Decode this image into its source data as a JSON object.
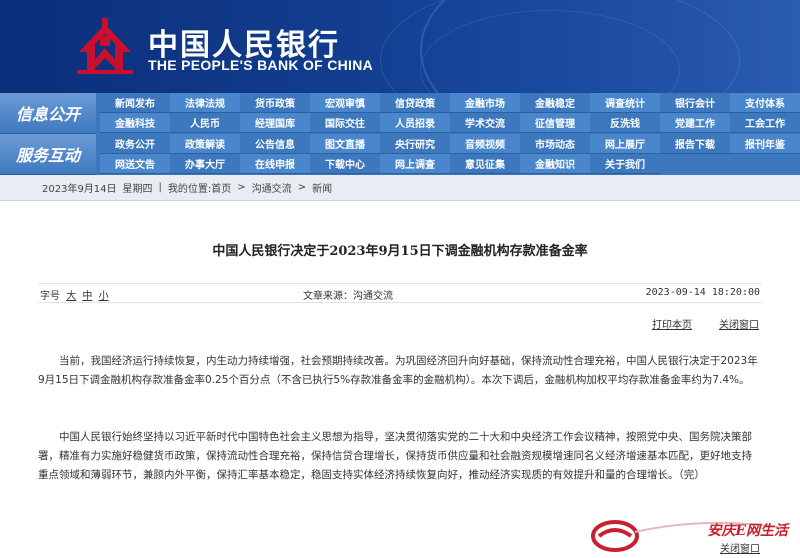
{
  "brand": {
    "name_cn": "中国人民银行",
    "name_en": "THE PEOPLE'S BANK OF CHINA",
    "logo": "pboc-logo-icon",
    "banner_color": "#123c8d",
    "logo_color": "#c8102e"
  },
  "nav": {
    "sections": [
      {
        "label": "信息公开",
        "rows": [
          [
            "新闻发布",
            "法律法规",
            "货币政策",
            "宏观审慎",
            "信贷政策",
            "金融市场",
            "金融稳定",
            "调查统计",
            "银行会计",
            "支付体系"
          ],
          [
            "金融科技",
            "人民币",
            "经理国库",
            "国际交往",
            "人员招录",
            "学术交流",
            "征信管理",
            "反洗钱",
            "党建工作",
            "工会工作"
          ]
        ]
      },
      {
        "label": "服务互动",
        "rows": [
          [
            "政务公开",
            "政策解读",
            "公告信息",
            "图文直播",
            "央行研究",
            "音频视频",
            "市场动态",
            "网上展厅",
            "报告下载",
            "报刊年鉴"
          ],
          [
            "网送文告",
            "办事大厅",
            "在线申报",
            "下载中心",
            "网上调查",
            "意见征集",
            "金融知识",
            "关于我们"
          ]
        ]
      }
    ]
  },
  "breadcrumb": {
    "date": "2023年9月14日",
    "weekday": "星期四",
    "location_label": "我的位置:",
    "home": "首页",
    "sep": ">",
    "level1": "沟通交流",
    "level2": "新闻"
  },
  "article": {
    "title": "中国人民银行决定于2023年9月15日下调金融机构存款准备金率",
    "font_size_label": "字号",
    "font_sizes": [
      "大",
      "中",
      "小"
    ],
    "source": "文章来源：沟通交流",
    "datetime": "2023-09-14 18:20:00",
    "print_label": "打印本页",
    "close_label": "关闭窗口",
    "paragraphs": [
      "当前，我国经济运行持续恢复，内生动力持续增强，社会预期持续改善。为巩固经济回升向好基础，保持流动性合理充裕，中国人民银行决定于2023年9月15日下调金融机构存款准备金率0.25个百分点（不含已执行5%存款准备金率的金融机构）。本次下调后，金融机构加权平均存款准备金率约为7.4%。",
      "中国人民银行始终坚持以习近平新时代中国特色社会主义思想为指导，坚决贯彻落实党的二十大和中央经济工作会议精神，按照党中央、国务院决策部署，精准有力实施好稳健货币政策，保持流动性合理充裕，保持信贷合理增长，保持货币供应量和社会融资规模增速同名义经济增速基本匹配，更好地支持重点领域和薄弱环节，兼顾内外平衡，保持汇率基本稳定，稳固支持实体经济持续恢复向好，推动经济实现质的有效提升和量的合理增长。（完）"
    ]
  },
  "watermark": {
    "text": "安庆E网生活",
    "close_label": "关闭窗口"
  }
}
